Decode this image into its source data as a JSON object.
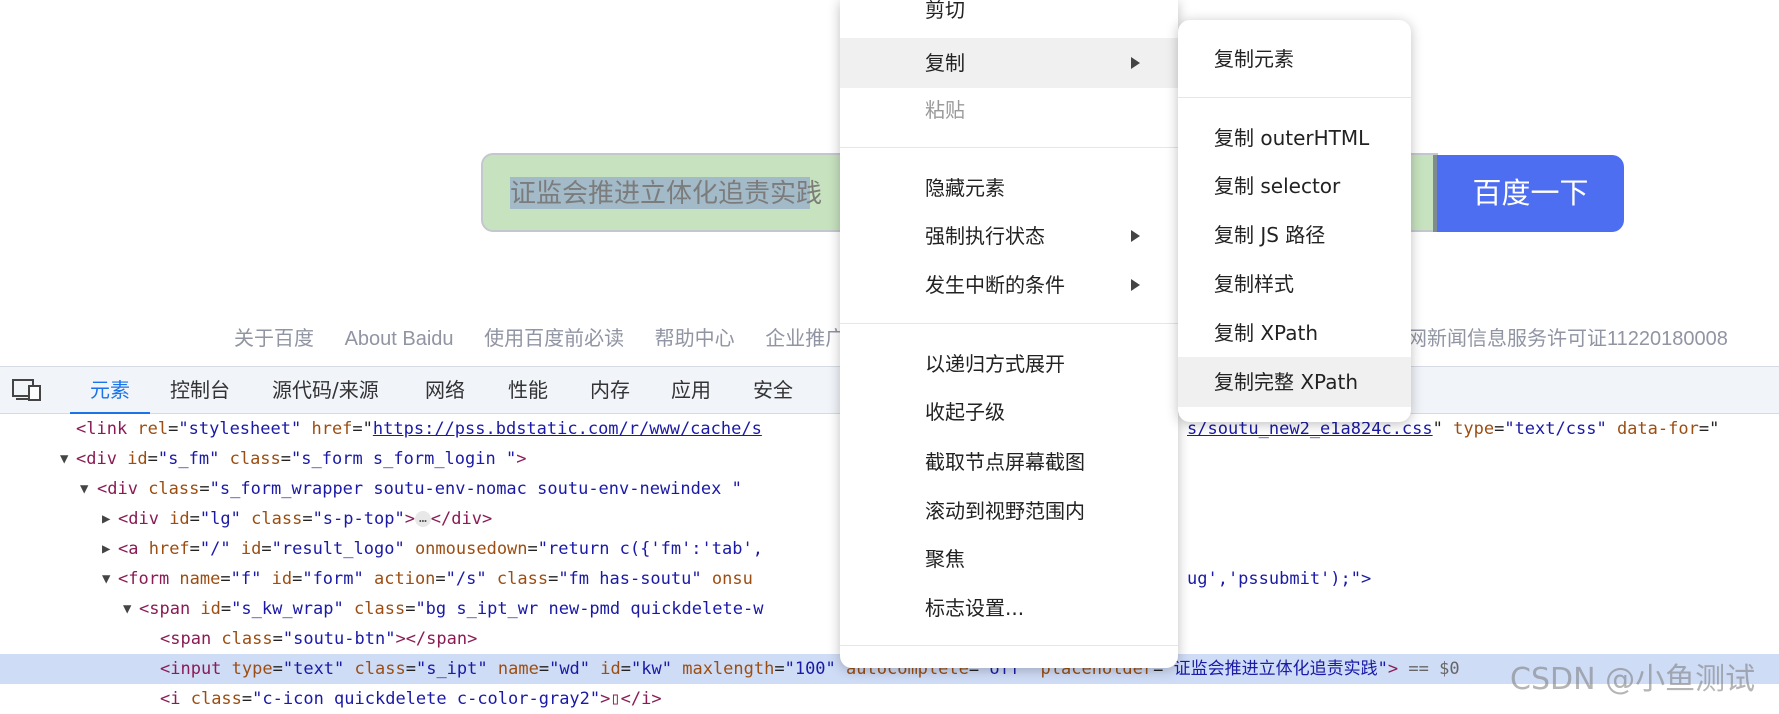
{
  "search": {
    "value": "证监会推进立体化追责实践",
    "button_label": "百度一下"
  },
  "footer": {
    "links": [
      "关于百度",
      "About Baidu",
      "使用百度前必读",
      "帮助中心",
      "企业推广"
    ],
    "license_fragment": "网新闻信息服务许可证11220180008"
  },
  "devtools": {
    "tabs": [
      "元素",
      "控制台",
      "源代码/来源",
      "网络",
      "性能",
      "内存",
      "应用",
      "安全"
    ],
    "active_tab": "元素",
    "code": {
      "l1": {
        "tag_open": "<link ",
        "a1": "rel",
        "v1": "\"stylesheet\"",
        "a2": "href",
        "url": "https://pss.bdstatic.com/r/www/cache/s",
        "url_tail": "s/soutu_new2_e1a824c.css",
        "a3": "type",
        "v3": "\"text/css\"",
        "a4": "data-for",
        "v4": "="
      },
      "l2": {
        "t": "<div ",
        "a1": "id",
        "v1": "\"s_fm\"",
        "a2": "class",
        "v2": "\"s_form s_form_login \"",
        "end": ">"
      },
      "l3": {
        "t": "<div ",
        "a1": "class",
        "v1": "\"s_form_wrapper  soutu-env-nomac soutu-env-newindex \"",
        "end": ">"
      },
      "l4": {
        "t": "<div ",
        "a1": "id",
        "v1": "\"lg\"",
        "a2": "class",
        "v2": "\"s-p-top\"",
        "end": ">",
        "ell": "…",
        "close": "</div>"
      },
      "l5": {
        "t": "<a ",
        "a1": "href",
        "v1": "\"/\"",
        "a2": "id",
        "v2": "\"result_logo\"",
        "a3": "onmousedown",
        "v3": "\"return c({'fm':'tab',"
      },
      "l6": {
        "t": "<form ",
        "a1": "name",
        "v1": "\"f\"",
        "a2": "id",
        "v2": "\"form\"",
        "a3": "action",
        "v3": "\"/s\"",
        "a4": "class",
        "v4": "\"fm  has-soutu\"",
        "a5": "onsu",
        "tail": "ug','pssubmit');\">"
      },
      "l7": {
        "t": "<span ",
        "a1": "id",
        "v1": "\"s_kw_wrap\"",
        "a2": "class",
        "v2": "\"bg s_ipt_wr new-pmd quickdelete-w"
      },
      "l8": {
        "t": "<span ",
        "a1": "class",
        "v1": "\"soutu-btn\"",
        "end": "></span>"
      },
      "l9": {
        "t": "<input ",
        "a1": "type",
        "v1": "\"text\"",
        "a2": "class",
        "v2": "\"s_ipt\"",
        "a3": "name",
        "v3": "\"wd\"",
        "a4": "id",
        "v4": "\"kw\"",
        "a5": "maxlength",
        "v5": "\"100\"",
        "a6": "autocomplete",
        "v6": "\"off\"",
        "a7": "placeholder",
        "v7": "\"证监会推进立体化追责实践\"",
        "end": ">",
        "dollar": "== $0"
      },
      "l10": {
        "t": "<i ",
        "a1": "class",
        "v1": "\"c-icon quickdelete c-color-gray2\"",
        "end": ">▯</i>"
      }
    }
  },
  "context_menu": {
    "items": {
      "cut": "剪切",
      "copy": "复制",
      "paste": "粘贴",
      "hide": "隐藏元素",
      "force_state": "强制执行状态",
      "break_on": "发生中断的条件",
      "expand": "以递归方式展开",
      "collapse": "收起子级",
      "screenshot": "截取节点屏幕截图",
      "scroll": "滚动到视野范围内",
      "focus": "聚焦",
      "badge": "标志设置..."
    }
  },
  "copy_submenu": {
    "items": [
      "复制元素",
      "复制 outerHTML",
      "复制 selector",
      "复制 JS 路径",
      "复制样式",
      "复制 XPath",
      "复制完整 XPath"
    ]
  },
  "watermark": "CSDN @小鱼测试"
}
